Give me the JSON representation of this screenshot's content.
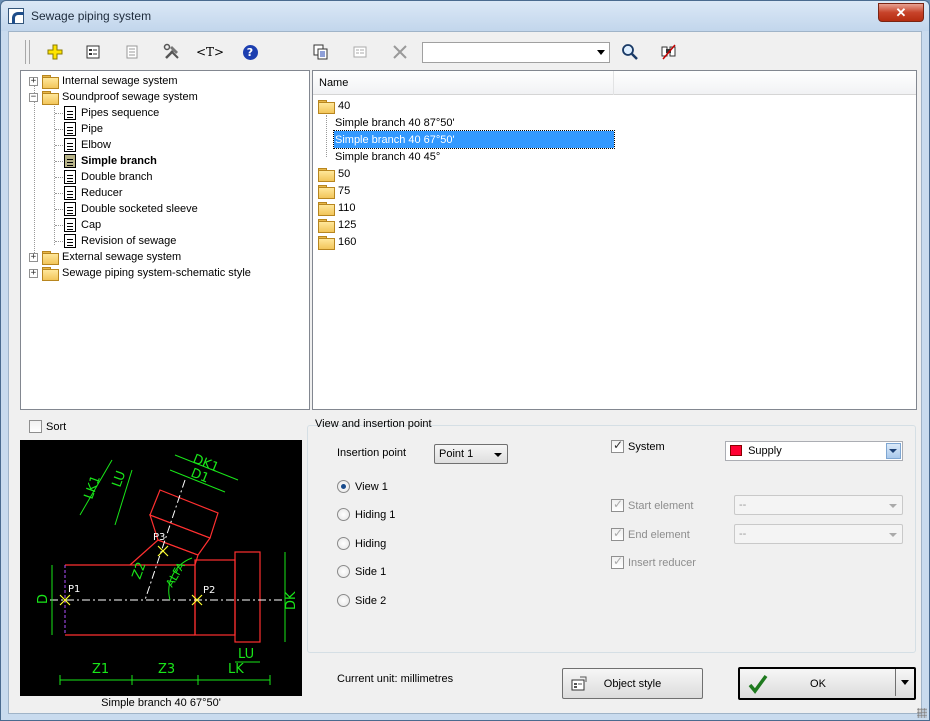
{
  "window": {
    "title": "Sewage piping system",
    "close_label": "✕"
  },
  "toolbar": {
    "icons": [
      "add-icon",
      "properties-icon",
      "edit-icon",
      "tools-icon",
      "text-tag-icon",
      "help-icon",
      "copy-icon",
      "paste-icon",
      "delete-icon",
      "search-icon",
      "find-in-drawing-icon"
    ],
    "text_tag_glyph": "<T>",
    "help_glyph": "?",
    "search_value": ""
  },
  "tree": {
    "items": [
      {
        "label": "Internal sewage system",
        "expander": "+"
      },
      {
        "label": "Soundproof sewage system",
        "expander": "−"
      },
      {
        "label": "Pipes sequence"
      },
      {
        "label": "Pipe"
      },
      {
        "label": "Elbow"
      },
      {
        "label": "Simple branch"
      },
      {
        "label": "Double branch"
      },
      {
        "label": "Reducer"
      },
      {
        "label": "Double socketed sleeve"
      },
      {
        "label": "Cap"
      },
      {
        "label": "Revision of sewage"
      },
      {
        "label": "External sewage system",
        "expander": "+"
      },
      {
        "label": "Sewage piping system-schematic style",
        "expander": "+"
      }
    ]
  },
  "list": {
    "column_header": "Name",
    "rows": [
      {
        "label": "40"
      },
      {
        "label": "Simple branch 40 87°50'"
      },
      {
        "label": "Simple branch 40 67°50'"
      },
      {
        "label": "Simple branch 40 45°"
      },
      {
        "label": "50"
      },
      {
        "label": "75"
      },
      {
        "label": "110"
      },
      {
        "label": "125"
      },
      {
        "label": "160"
      }
    ]
  },
  "sort": {
    "label": "Sort",
    "checked": false
  },
  "preview": {
    "caption": "Simple branch 40 67°50'",
    "labels": {
      "lk1": "LK1",
      "lu_top": "LU",
      "dk1": "DK1",
      "d1": "D1",
      "p3": "P3",
      "z2": "Z2",
      "alfa": "ALFA",
      "p1": "P1",
      "p2": "P2",
      "d": "D",
      "dk": "DK",
      "lu": "LU",
      "z1": "Z1",
      "z3": "Z3",
      "lk": "LK"
    }
  },
  "view_group": {
    "title": "View and insertion point",
    "insertion_point_label": "Insertion point",
    "insertion_point_value": "Point 1",
    "views": [
      "View 1",
      "Hiding 1",
      "Hiding",
      "Side 1",
      "Side 2"
    ],
    "selected_view": "View 1",
    "system_label": "System",
    "system_value": "Supply",
    "system_color": "#ff0033",
    "start_element_label": "Start element",
    "start_element_value": "--",
    "end_element_label": "End element",
    "end_element_value": "--",
    "insert_reducer_label": "Insert reducer"
  },
  "footer": {
    "current_unit": "Current unit: millimetres",
    "object_style_label": "Object style",
    "ok_label": "OK"
  }
}
